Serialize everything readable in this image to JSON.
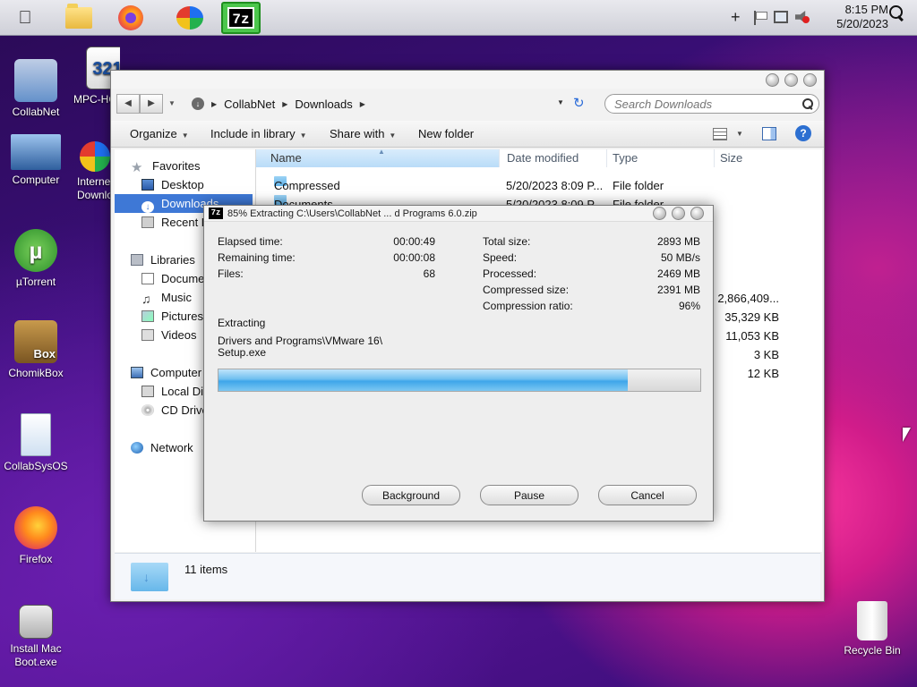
{
  "menubar": {
    "clock_time": "8:15 PM",
    "clock_date": "5/20/2023",
    "apps": [
      "file-explorer",
      "firefox",
      "internet-download-manager",
      "7-zip"
    ],
    "sevenzip_label": "7z",
    "plus_label": "+"
  },
  "desktop": {
    "icons": [
      {
        "label": "CollabNet"
      },
      {
        "label": "MPC-HC"
      },
      {
        "label": "Computer"
      },
      {
        "label": "Internet Download"
      },
      {
        "label": "µTorrent"
      },
      {
        "label": "ChomikBox"
      },
      {
        "label": "CollabSysOS"
      },
      {
        "label": "Firefox"
      },
      {
        "label": "Install Mac Boot.exe"
      },
      {
        "label": "Recycle Bin"
      }
    ],
    "box_overlay": "Box",
    "mpc_overlay": "321"
  },
  "explorer": {
    "breadcrumb": [
      "CollabNet",
      "Downloads"
    ],
    "search_placeholder": "Search Downloads",
    "toolbar": {
      "organize": "Organize",
      "include_in_library": "Include in library",
      "share_with": "Share with",
      "new_folder": "New folder"
    },
    "nav": {
      "favorites": "Favorites",
      "desktop": "Desktop",
      "downloads": "Downloads",
      "recent_places": "Recent Places",
      "libraries": "Libraries",
      "documents": "Documents",
      "music": "Music",
      "pictures": "Pictures",
      "videos": "Videos",
      "computer": "Computer",
      "local_disk": "Local Disk",
      "cd_drive": "CD Drive",
      "network": "Network"
    },
    "columns": {
      "name": "Name",
      "date_modified": "Date modified",
      "type": "Type",
      "size": "Size"
    },
    "files": [
      {
        "name": "Compressed",
        "date": "5/20/2023 8:09 P...",
        "type": "File folder",
        "size": ""
      },
      {
        "name": "Documents",
        "date": "5/20/2023 8:09 P...",
        "type": "File folder",
        "size": ""
      }
    ],
    "partial_sizes": [
      "2,866,409...",
      "35,329 KB",
      "11,053 KB",
      "3 KB",
      "12 KB"
    ],
    "status_items": "11 items"
  },
  "dialog": {
    "title": "85% Extracting C:\\Users\\CollabNet ... d Programs 6.0.zip",
    "icon_label": "7z",
    "elapsed_label": "Elapsed time:",
    "elapsed_value": "00:00:49",
    "remaining_label": "Remaining time:",
    "remaining_value": "00:00:08",
    "files_label": "Files:",
    "files_value": "68",
    "total_size_label": "Total size:",
    "total_size_value": "2893 MB",
    "speed_label": "Speed:",
    "speed_value": "50 MB/s",
    "processed_label": "Processed:",
    "processed_value": "2469 MB",
    "compressed_size_label": "Compressed size:",
    "compressed_size_value": "2391 MB",
    "ratio_label": "Compression ratio:",
    "ratio_value": "96%",
    "operation": "Extracting",
    "current_path_line1": "Drivers and Programs\\VMware 16\\",
    "current_path_line2": "Setup.exe",
    "progress_fraction": 0.85,
    "buttons": {
      "background": "Background",
      "pause": "Pause",
      "cancel": "Cancel"
    }
  }
}
